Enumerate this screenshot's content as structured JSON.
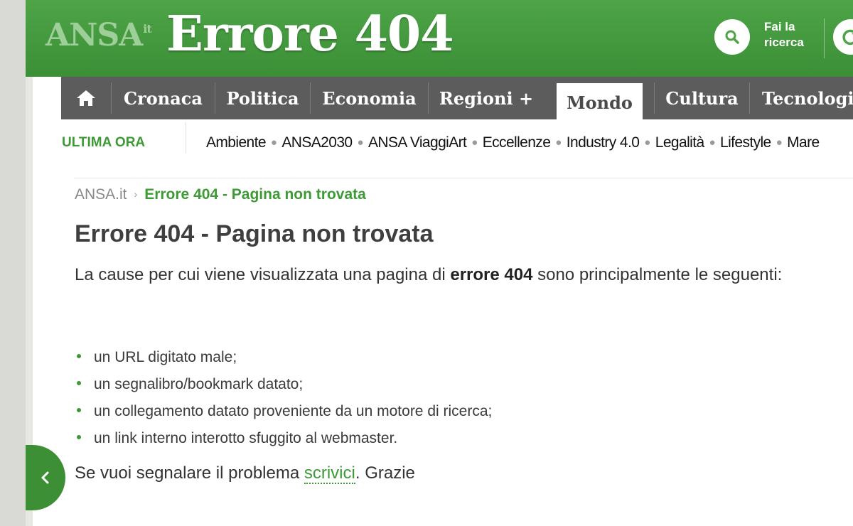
{
  "header": {
    "logo_text": "ANSA",
    "logo_suffix": "it",
    "title": "Errore 404",
    "search_label_line1": "Fai la",
    "search_label_line2": "ricerca",
    "search_icon": "search-icon",
    "reload_icon": "reload-icon"
  },
  "nav": {
    "home_icon": "home-icon",
    "items": [
      {
        "label": "Cronaca"
      },
      {
        "label": "Politica"
      },
      {
        "label": "Economia"
      },
      {
        "label": "Regioni +"
      },
      {
        "label": "Mondo",
        "active": true
      },
      {
        "label": "Cultura"
      },
      {
        "label": "Tecnologia"
      }
    ]
  },
  "subnav": {
    "label": "ULTIMA ORA",
    "links": [
      "Ambiente",
      "ANSA2030",
      "ANSA ViaggiArt",
      "Eccellenze",
      "Industry 4.0",
      "Legalità",
      "Lifestyle",
      "Mare"
    ]
  },
  "breadcrumb": {
    "home": "ANSA.it",
    "current": "Errore 404 - Pagina non trovata"
  },
  "main": {
    "heading": "Errore 404 - Pagina non trovata",
    "intro_pre": "La cause per cui viene visualizzata una pagina di ",
    "intro_bold": "errore 404",
    "intro_post": " sono principalmente le seguenti:",
    "bullets": [
      "un URL digitato male;",
      "un segnalibro/bookmark datato;",
      "un collegamento datato proveniente da un motore di ricerca;",
      "un link interno interotto sfuggito al webmaster."
    ],
    "report_pre": "Se vuoi segnalare il problema ",
    "report_link": "scrivici",
    "report_post": ". Grazie"
  },
  "side_tab": {
    "icon": "chevron-left-icon"
  },
  "colors": {
    "brand_green": "#3d9a35",
    "header_green": "#4ea447",
    "nav_gray": "#5c5c5c"
  }
}
